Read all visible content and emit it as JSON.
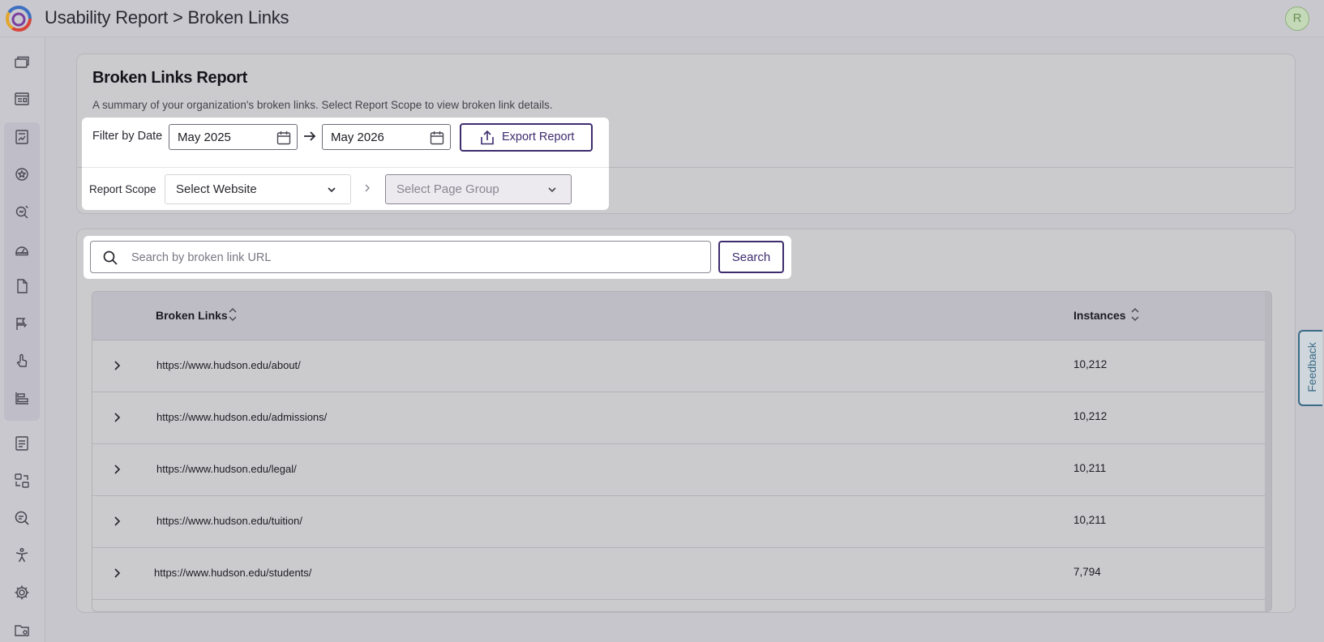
{
  "header": {
    "title": "Usability Report > Broken Links",
    "avatar_initial": "R"
  },
  "sidebar": {
    "icons": [
      "windows-icon",
      "dashboard-card-icon",
      "report-icon",
      "badge-icon",
      "search-analytics-icon",
      "gauge-icon",
      "page-icon",
      "flag-icon",
      "hand-pointer-icon",
      "bar-align-icon",
      "document-list-icon",
      "transfer-icon",
      "search-insights-icon",
      "accessibility-icon",
      "gear-icon",
      "folder-settings-icon"
    ]
  },
  "report": {
    "title": "Broken Links Report",
    "description": "A summary of your organization's broken links. Select Report Scope to view broken link details."
  },
  "filters": {
    "date_label": "Filter by Date",
    "start_date": "May 2025",
    "end_date": "May 2026",
    "export_label": "Export Report",
    "scope_label": "Report Scope",
    "website_select": "Select Website",
    "page_group_select": "Select Page Group"
  },
  "search": {
    "placeholder": "Search by broken link URL",
    "button_label": "Search"
  },
  "table": {
    "columns": [
      "Broken Links",
      "Instances"
    ],
    "rows": [
      {
        "url": "https://www.hudson.edu/about/",
        "instances": "10,212"
      },
      {
        "url": "https://www.hudson.edu/admissions/",
        "instances": "10,212"
      },
      {
        "url": "https://www.hudson.edu/legal/",
        "instances": "10,211"
      },
      {
        "url": "https://www.hudson.edu/tuition/",
        "instances": "10,211"
      },
      {
        "url": "https://www.hudson.edu/students/",
        "instances": "7,794"
      }
    ]
  },
  "feedback_label": "Feedback",
  "colors": {
    "accent": "#3e2c6e",
    "feedback": "#3a6b87",
    "overlay_bg": "#c7c6cc"
  }
}
